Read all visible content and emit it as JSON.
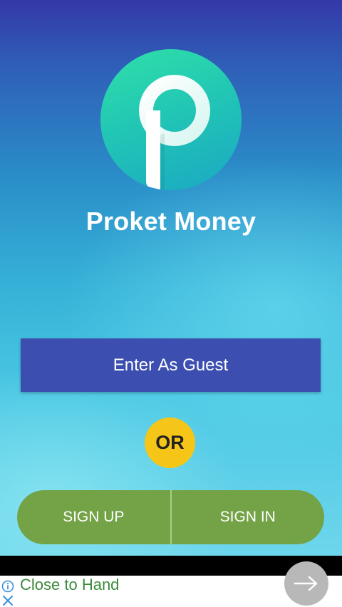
{
  "app": {
    "name": "Proket Money",
    "logo_letter": "P"
  },
  "actions": {
    "guest_label": "Enter As Guest",
    "or_label": "OR",
    "signup_label": "SIGN UP",
    "signin_label": "SIGN IN"
  },
  "ad": {
    "text": "Close to Hand",
    "info_icon": "info-icon",
    "close_icon": "close-icon",
    "arrow_icon": "arrow-right-icon"
  },
  "colors": {
    "guest_button": "#3c4fb0",
    "or_badge": "#f5c518",
    "auth_buttons": "#74a347",
    "logo_gradient_start": "#2fe0a8",
    "logo_gradient_end": "#1aa8c4",
    "ad_text": "#3b8a3a"
  }
}
